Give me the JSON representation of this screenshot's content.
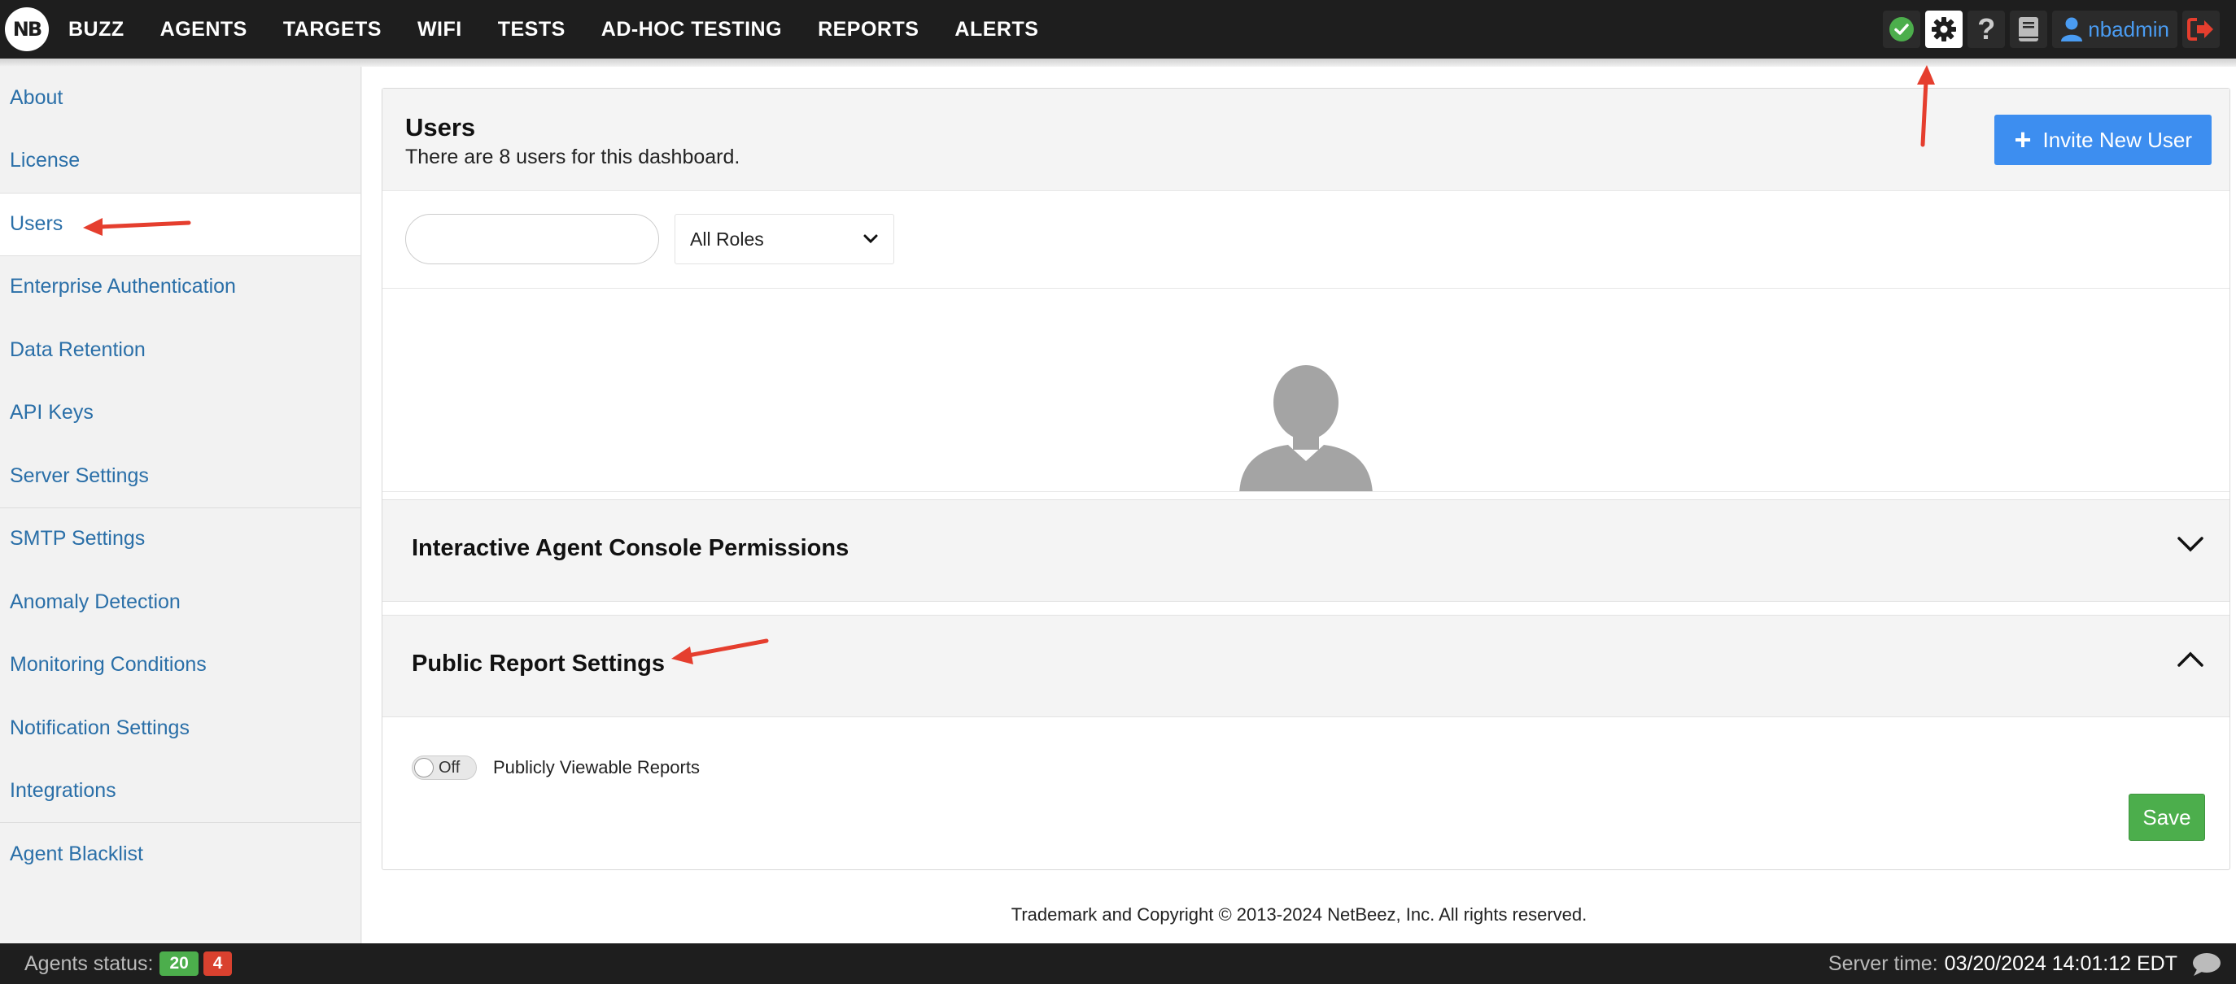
{
  "nav": {
    "logo_text": "NB",
    "items": [
      "BUZZ",
      "AGENTS",
      "TARGETS",
      "WIFI",
      "TESTS",
      "AD-HOC TESTING",
      "REPORTS",
      "ALERTS"
    ],
    "help_glyph": "?",
    "username": "nbadmin"
  },
  "icons": {
    "status": "check-circle-icon",
    "settings": "gear-icon",
    "help": "question-icon",
    "docs": "book-icon",
    "user": "user-icon",
    "logout": "logout-icon"
  },
  "sidebar": {
    "items": [
      {
        "label": "About"
      },
      {
        "label": "License"
      },
      {
        "label": "Users"
      },
      {
        "label": "Enterprise Authentication"
      },
      {
        "label": "Data Retention"
      },
      {
        "label": "API Keys"
      },
      {
        "label": "Server Settings"
      },
      {
        "label": "SMTP Settings"
      },
      {
        "label": "Anomaly Detection"
      },
      {
        "label": "Monitoring Conditions"
      },
      {
        "label": "Notification Settings"
      },
      {
        "label": "Integrations"
      },
      {
        "label": "Agent Blacklist"
      }
    ],
    "active": "Users"
  },
  "users_panel": {
    "title": "Users",
    "subtitle": "There are 8 users for this dashboard.",
    "invite_label": "Invite New User",
    "invite_plus": "+",
    "search_value": "",
    "search_placeholder": "",
    "role_selected": "All Roles"
  },
  "sections": {
    "console_permissions": "Interactive Agent Console Permissions",
    "public_report": "Public Report Settings"
  },
  "public_report": {
    "toggle_state": "Off",
    "toggle_label": "Publicly Viewable Reports",
    "save_label": "Save"
  },
  "footer": {
    "copyright": "Trademark and Copyright © 2013-2024 NetBeez, Inc. All rights reserved."
  },
  "statusbar": {
    "agents_label": "Agents status:",
    "agents_up": "20",
    "agents_down": "4",
    "server_time_label": "Server time:",
    "server_time_value": "03/20/2024 14:01:12 EDT"
  },
  "colors": {
    "nav_bg": "#1e1e1e",
    "link_blue": "#2a6fa8",
    "invite_blue": "#3d8ef0",
    "save_green": "#4cae4c",
    "status_green": "#4cae4c",
    "status_red": "#d9412f",
    "annotation_red": "#e53e2e"
  }
}
